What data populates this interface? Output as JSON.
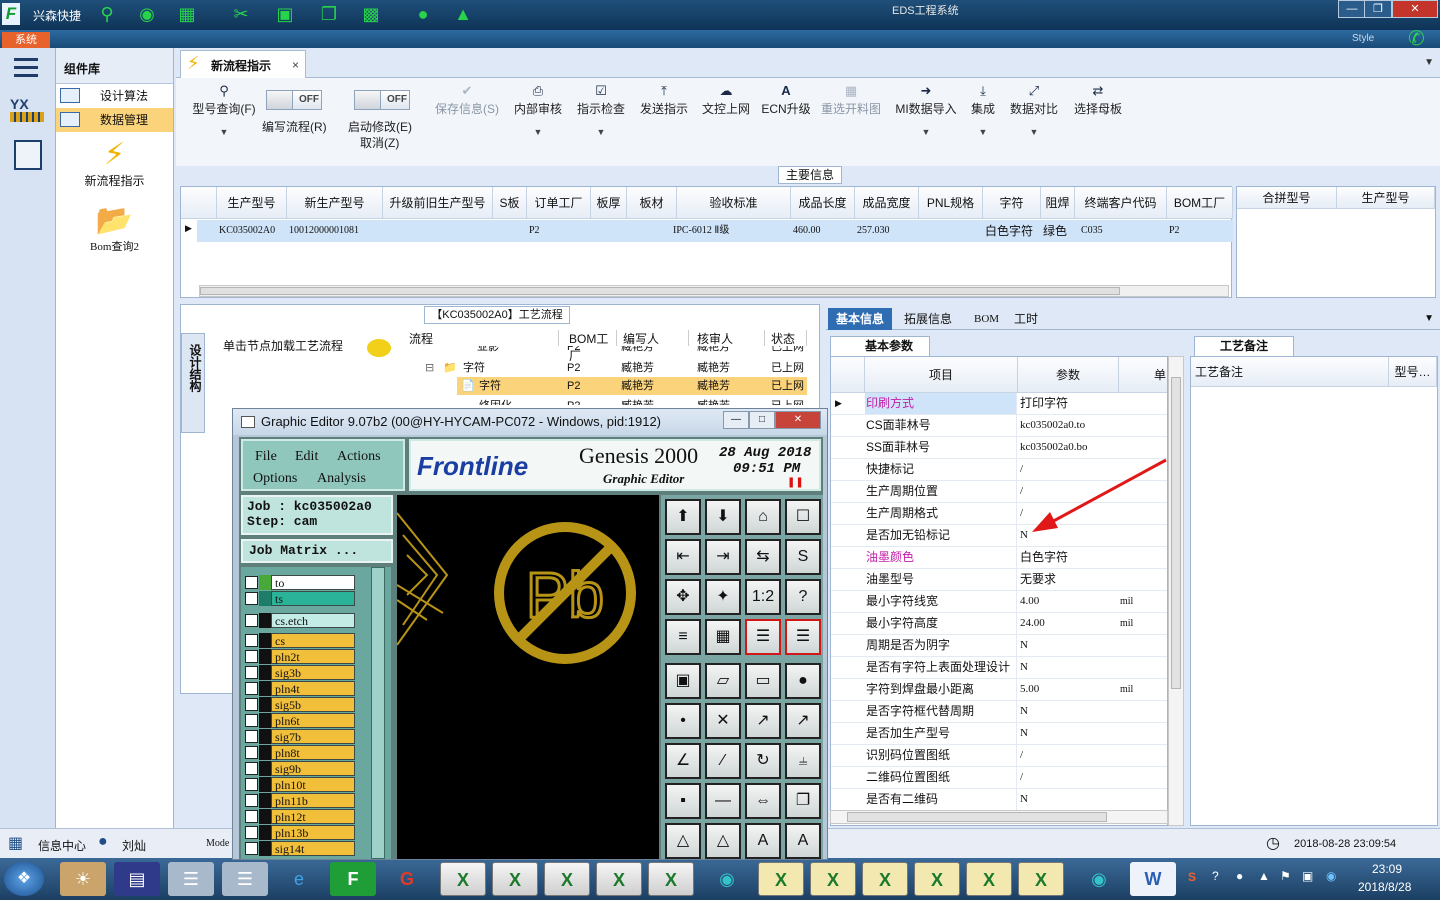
{
  "titlebar": {
    "app_name": "兴森快捷",
    "window_title": "EDS工程系统",
    "system_tab": "系统",
    "style_label": "Style"
  },
  "component_panel": {
    "title": "组件库",
    "items": [
      {
        "label": "设计算法",
        "selected": false
      },
      {
        "label": "数据管理",
        "selected": true
      }
    ],
    "big_items": [
      {
        "label": "新流程指示",
        "icon": "lightning-icon"
      },
      {
        "label": "Bom查询2",
        "icon": "folder-icon"
      }
    ]
  },
  "main_tab": {
    "label": "新流程指示"
  },
  "toolbar": {
    "buttons": [
      {
        "label": "型号查询(F)",
        "icon": "search-icon"
      },
      {
        "label": "保存信息(S)",
        "icon": "check-icon",
        "disabled": true
      },
      {
        "label": "内部审核",
        "icon": "printer-icon"
      },
      {
        "label": "指示检查",
        "icon": "checkbox-icon"
      },
      {
        "label": "发送指示",
        "icon": "upload-icon"
      },
      {
        "label": "文控上网",
        "icon": "cloud-upload-icon"
      },
      {
        "label": "ECN升级",
        "icon": "ecn-icon"
      },
      {
        "label": "重选开料图",
        "icon": "image-icon",
        "disabled": true
      },
      {
        "label": "MI数据导入",
        "icon": "import-icon"
      },
      {
        "label": "集成",
        "icon": "download-icon"
      },
      {
        "label": "数据对比",
        "icon": "compare-icon"
      },
      {
        "label": "选择母板",
        "icon": "shuffle-icon"
      }
    ],
    "toggle_edit": {
      "label": "编写流程(R)",
      "value": "OFF"
    },
    "toggle_modify": {
      "label": "启动修改(E)",
      "value": "OFF",
      "sub_label": "取消(Z)"
    }
  },
  "main_info": {
    "title": "主要信息",
    "columns": [
      "生产型号",
      "新生产型号",
      "升级前旧生产型号",
      "S板",
      "订单工厂",
      "板厚",
      "板材",
      "验收标准",
      "成品长度",
      "成品宽度",
      "PNL规格",
      "字符",
      "阻焊",
      "终端客户代码",
      "BOM工厂"
    ],
    "row": [
      "KC035002A0",
      "10012000001081",
      "",
      "",
      "P2",
      "",
      "",
      "IPC-6012 Ⅱ级",
      "460.00",
      "257.030",
      "",
      "白色字符",
      "绿色",
      "C035",
      "P2"
    ],
    "merge_columns": [
      "合拼型号",
      "生产型号"
    ]
  },
  "process_panel": {
    "title": "【KC035002A0】工艺流程",
    "side_label": "设计结构",
    "hint": "单击节点加载工艺流程",
    "tree_headers": [
      "流程",
      "BOM工厂",
      "编写人",
      "核审人",
      "状态"
    ],
    "tree_rows": [
      {
        "name": "亚影",
        "factory": "P2",
        "writer": "臧艳芳",
        "reviewer": "臧艳芳",
        "status": "已上网"
      },
      {
        "name": "字符",
        "factory": "P2",
        "writer": "臧艳芳",
        "reviewer": "臧艳芳",
        "status": "已上网"
      },
      {
        "name": "字符",
        "factory": "P2",
        "writer": "臧艳芳",
        "reviewer": "臧艳芳",
        "status": "已上网",
        "selected": true
      },
      {
        "name": "终固化",
        "factory": "P2",
        "writer": "臧艳芳",
        "reviewer": "臧艳芳",
        "status": "已上网"
      }
    ]
  },
  "right_panel": {
    "tabs": [
      "基本信息",
      "拓展信息",
      "BOM",
      "工时"
    ],
    "basic_params_title": "基本参数",
    "columns": [
      "项目",
      "参数",
      "单"
    ],
    "params": [
      {
        "item": "印刷方式",
        "value": "打印字符",
        "unit": "",
        "highlight": true
      },
      {
        "item": "CS面菲林号",
        "value": "kc035002a0.to",
        "unit": ""
      },
      {
        "item": "SS面菲林号",
        "value": "kc035002a0.bo",
        "unit": ""
      },
      {
        "item": "快捷标记",
        "value": "/",
        "unit": ""
      },
      {
        "item": "生产周期位置",
        "value": "/",
        "unit": ""
      },
      {
        "item": "生产周期格式",
        "value": "/",
        "unit": ""
      },
      {
        "item": "是否加无铅标记",
        "value": "N",
        "unit": ""
      },
      {
        "item": "油墨颜色",
        "value": "白色字符",
        "unit": "",
        "highlight": true
      },
      {
        "item": "油墨型号",
        "value": "无要求",
        "unit": ""
      },
      {
        "item": "最小字符线宽",
        "value": "4.00",
        "unit": "mil"
      },
      {
        "item": "最小字符高度",
        "value": "24.00",
        "unit": "mil"
      },
      {
        "item": "周期是否为阴字",
        "value": "N",
        "unit": ""
      },
      {
        "item": "是否有字符上表面处理设计",
        "value": "N",
        "unit": ""
      },
      {
        "item": "字符到焊盘最小距离",
        "value": "5.00",
        "unit": "mil"
      },
      {
        "item": "是否字符框代替周期",
        "value": "N",
        "unit": ""
      },
      {
        "item": "是否加生产型号",
        "value": "N",
        "unit": ""
      },
      {
        "item": "识别码位置图纸",
        "value": "/",
        "unit": ""
      },
      {
        "item": "二维码位置图纸",
        "value": "/",
        "unit": ""
      },
      {
        "item": "是否有二维码",
        "value": "N",
        "unit": ""
      }
    ],
    "craft_note_tab": "工艺备注",
    "craft_columns": [
      "工艺备注",
      "型号…"
    ]
  },
  "graphic_editor": {
    "title": "Graphic Editor 9.07b2 (00@HY-HYCAM-PC072 - Windows, pid:1912)",
    "menu": [
      "File",
      "Edit",
      "Actions",
      "Options",
      "Analysis"
    ],
    "brand": "Frontline",
    "product": "Genesis 2000",
    "subtitle": "Graphic Editor",
    "date": "28 Aug 2018",
    "time": "09:51 PM",
    "job": "Job : kc035002a0",
    "step": "Step: cam",
    "job_matrix": "Job Matrix ...",
    "canvas_text": "Pb",
    "layers": [
      {
        "name": "to",
        "color": "#ffffff"
      },
      {
        "name": "ts",
        "color": "#2bb39a"
      },
      {
        "name": "cs.etch",
        "color": "#c4ece6"
      },
      {
        "name": "cs",
        "color": "#f1bf3a"
      },
      {
        "name": "pln2t",
        "color": "#f1bf3a"
      },
      {
        "name": "sig3b",
        "color": "#f1bf3a"
      },
      {
        "name": "pln4t",
        "color": "#f1bf3a"
      },
      {
        "name": "sig5b",
        "color": "#f1bf3a"
      },
      {
        "name": "pln6t",
        "color": "#f1bf3a"
      },
      {
        "name": "sig7b",
        "color": "#f1bf3a"
      },
      {
        "name": "pln8t",
        "color": "#f1bf3a"
      },
      {
        "name": "sig9b",
        "color": "#f1bf3a"
      },
      {
        "name": "pln10t",
        "color": "#f1bf3a"
      },
      {
        "name": "pln11b",
        "color": "#f1bf3a"
      },
      {
        "name": "pln12t",
        "color": "#f1bf3a"
      },
      {
        "name": "pln13b",
        "color": "#f1bf3a"
      },
      {
        "name": "sig14t",
        "color": "#f1bf3a"
      }
    ]
  },
  "statusbar": {
    "info_center": "信息中心",
    "user": "刘灿",
    "mode": "Mode",
    "datetime": "2018-08-28 23:09:54"
  },
  "taskbar": {
    "time": "23:09",
    "date": "2018/8/28"
  }
}
